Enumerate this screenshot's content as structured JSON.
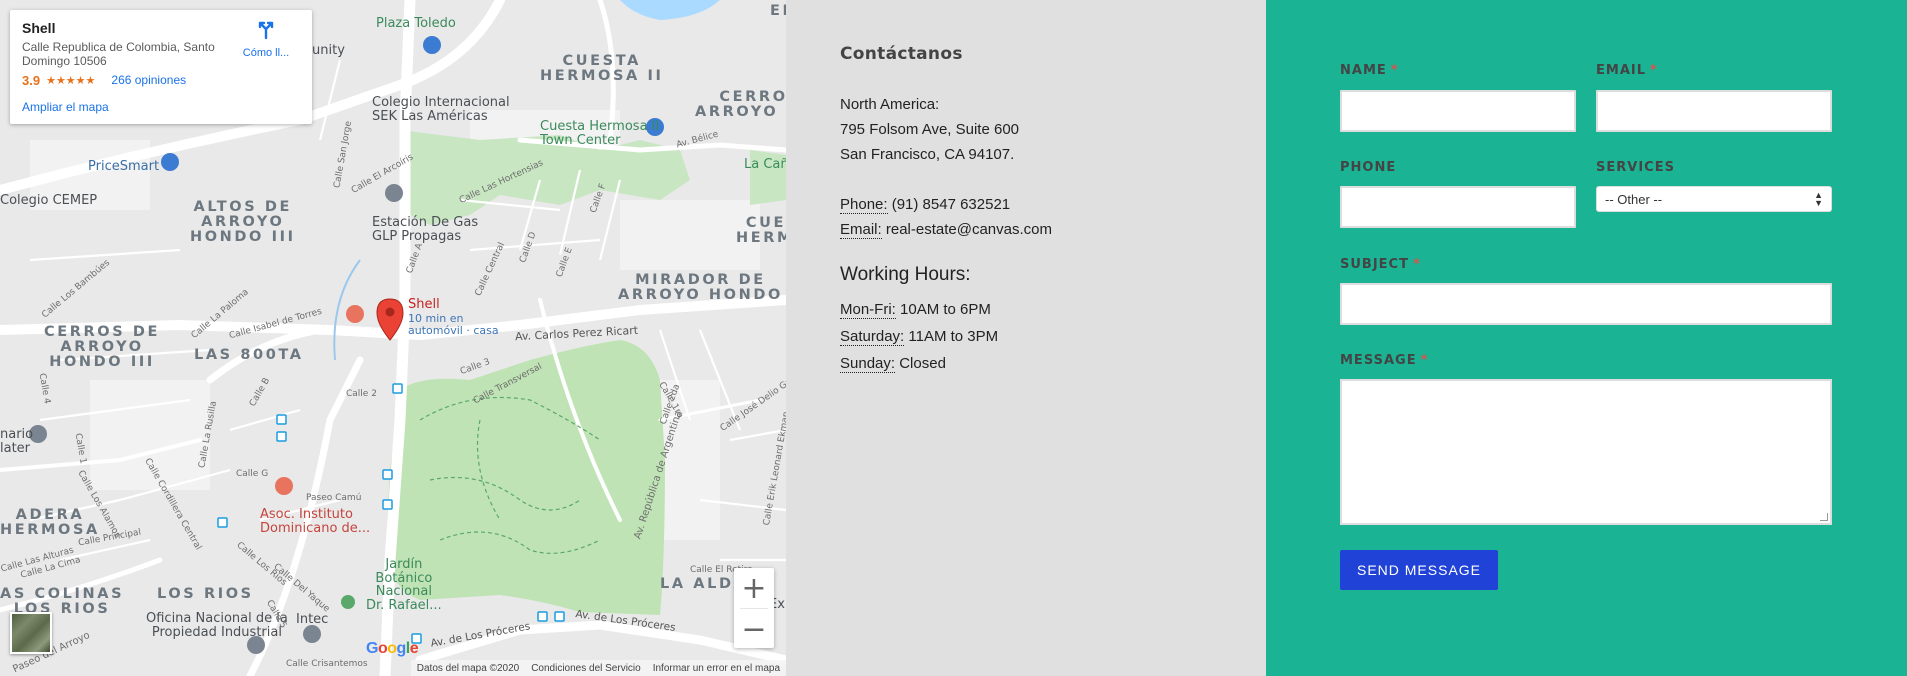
{
  "map": {
    "info_card": {
      "title": "Shell",
      "address": "Calle Republica de Colombia, Santo Domingo 10506",
      "rating": "3.9",
      "stars": "★★★★★",
      "reviews": "266 opiniones",
      "enlarge": "Ampliar el mapa",
      "directions": "Cómo ll..."
    },
    "districts": [
      "CUESTA\nHERMOSA II",
      "CERROS DE\nARROYO HONDO",
      "CUES\nHERMO",
      "ALTOS DE\nARROYO\nHONDO III",
      "MIRADOR DE\nARROYO HONDO",
      "CERROS DE\nARROYO\nHONDO III",
      "LAS 800TA",
      "ADERA\nHERMOSA",
      "LOS RIOS",
      "AS COLINAS\nLOS RIOS",
      "LA ALDA",
      "EI"
    ],
    "pois": [
      "Plaza Toledo",
      "Colegio Internacional\nSEK Las Américas",
      "Cuesta Hermosa II\nTown Center",
      "PriceSmart",
      "Colegio CEMEP",
      "Estación De Gas\nGLP Propagas",
      "La Cañ",
      "Asoc. Instituto\nDominicano de...",
      "Jardín\nBotánico\nNacional\nDr. Rafael...",
      "Oficina Nacional de la\nPropiedad Industrial",
      "Intec",
      "FedEx E",
      "nario\nlater",
      "unity"
    ],
    "pin_label": "Shell",
    "pin_route": "10 min en\nautomóvil · casa",
    "streets": [
      "Av. Carlos Perez Ricart",
      "Calle 2",
      "Calle 3",
      "Calle Transversal",
      "Av. República de Argentina",
      "Av. de Los Próceres",
      "Av. de Los Próceres",
      "Calle Central",
      "Calle Isabel de Torres",
      "Calle La Paloma",
      "Calle Los Bambúes",
      "Calle G",
      "Calle B",
      "Calle La Rusilla",
      "Paseo Camú",
      "Calle Cordillera Central",
      "Calle Los Alamos",
      "Calle Las Alturas",
      "Calle La Cima",
      "Calle Principal",
      "Calle Los Rios",
      "Calle Del Yaque",
      "Calle Crisantemos",
      "Paseo del Arroyo",
      "Calle Erik Leonard Ekman",
      "Calle José Delio Guzman",
      "Calle El Retiro",
      "Calle 2da",
      "Av. Bélice",
      "Calle Las Hortensias",
      "Calle El Arcoíris",
      "Calle San Jorge",
      "Calle 1ra",
      "Calle A",
      "Calle D",
      "Calle E",
      "Calle F",
      "Calle 5",
      "Calle 4",
      "Calle 1"
    ],
    "footer": [
      "Datos del mapa ©2020",
      "Condiciones del Servicio",
      "Informar un error en el mapa"
    ],
    "google": [
      "G",
      "o",
      "o",
      "g",
      "l",
      "e"
    ],
    "zoom_in": "+",
    "zoom_out": "−"
  },
  "contact": {
    "title": "Contáctanos",
    "region": "North America:",
    "address_line1": "795 Folsom Ave, Suite 600",
    "address_line2": "San Francisco, CA 94107.",
    "phone_label": "Phone:",
    "phone_value": " (91) 8547 632521",
    "email_label": "Email:",
    "email_value": " real-estate@canvas.com",
    "hours_title": "Working Hours:",
    "hours": [
      {
        "day": "Mon-Fri:",
        "time": " 10AM to 6PM"
      },
      {
        "day": "Saturday:",
        "time": " 11AM to 3PM"
      },
      {
        "day": "Sunday:",
        "time": " Closed"
      }
    ]
  },
  "form": {
    "name_label": "NAME",
    "email_label": "EMAIL",
    "phone_label": "PHONE",
    "services_label": "SERVICES",
    "services_selected": "-- Other --",
    "subject_label": "SUBJECT",
    "message_label": "MESSAGE",
    "required_mark": "*",
    "submit_label": "SEND MESSAGE"
  },
  "colors": {
    "form_bg": "#1ab394",
    "contact_bg": "#e0e0e0",
    "button_bg": "#2142d6"
  }
}
